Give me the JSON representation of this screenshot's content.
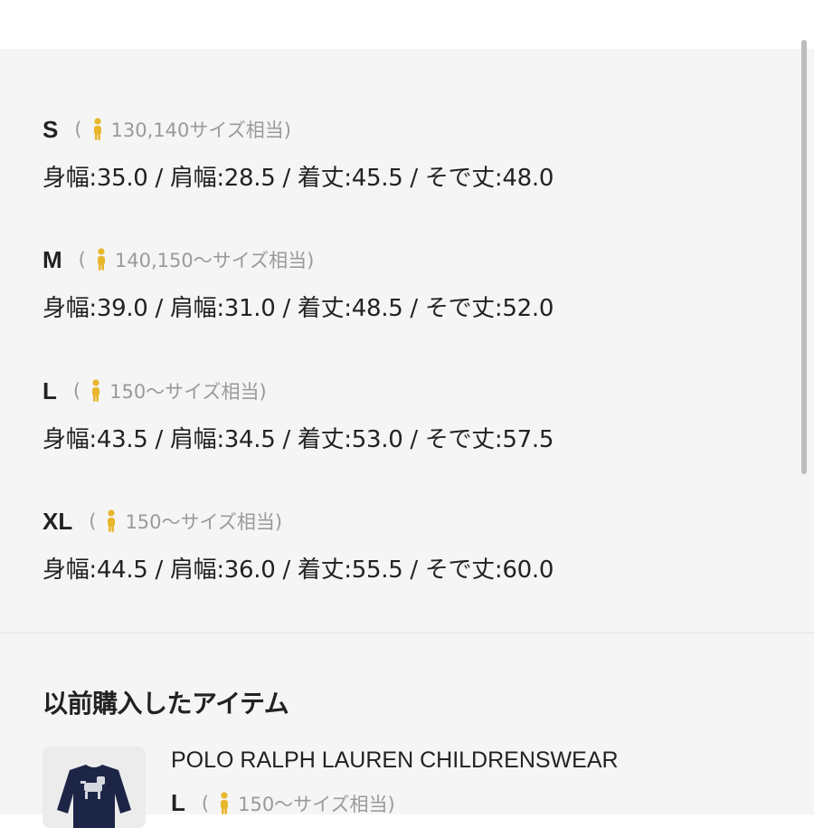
{
  "sizes": [
    {
      "label": "S",
      "open_paren": "(",
      "equivalent": "130,140サイズ相当)",
      "measurements": "身幅:35.0 / 肩幅:28.5 / 着丈:45.5 / そで丈:48.0"
    },
    {
      "label": "M",
      "open_paren": "(",
      "equivalent": "140,150〜サイズ相当)",
      "measurements": "身幅:39.0 / 肩幅:31.0 / 着丈:48.5 / そで丈:52.0"
    },
    {
      "label": "L",
      "open_paren": "(",
      "equivalent": "150〜サイズ相当)",
      "measurements": "身幅:43.5 / 肩幅:34.5 / 着丈:53.0 / そで丈:57.5"
    },
    {
      "label": "XL",
      "open_paren": "(",
      "equivalent": "150〜サイズ相当)",
      "measurements": "身幅:44.5 / 肩幅:36.0 / 着丈:55.5 / そで丈:60.0"
    }
  ],
  "history": {
    "title": "以前購入したアイテム",
    "item": {
      "brand": "POLO RALPH LAUREN CHILDRENSWEAR",
      "size_label": "L",
      "open_paren": "(",
      "equivalent": "150〜サイズ相当)"
    }
  },
  "icons": {
    "person": "person-icon",
    "thumbnail": "navy-sweater-thumbnail"
  },
  "colors": {
    "panel_bg": "#f5f5f5",
    "icon_yellow": "#e8b62c",
    "muted_text": "#9a9a9a",
    "sweater_navy": "#1d2547"
  }
}
